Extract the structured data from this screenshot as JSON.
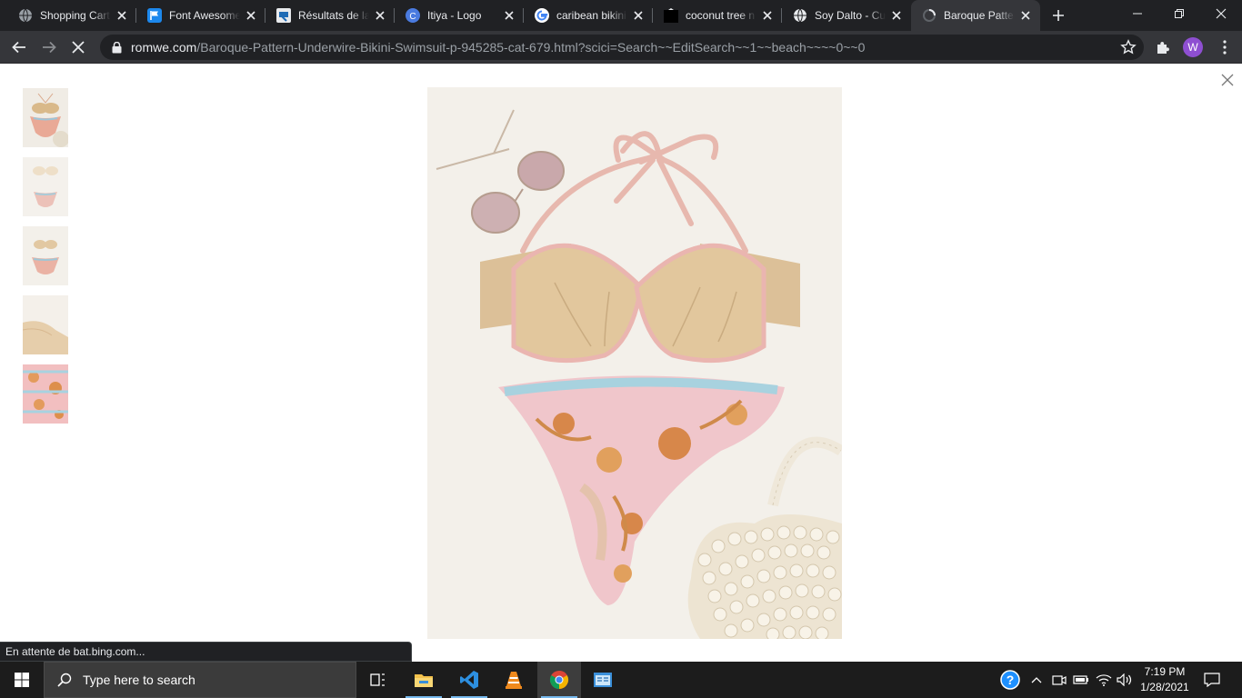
{
  "browser": {
    "tabs": [
      {
        "title": "Shopping Cart",
        "icon": "globe-icon"
      },
      {
        "title": "Font Awesome",
        "icon": "flag-icon"
      },
      {
        "title": "Résultats de la",
        "icon": "image-search-icon"
      },
      {
        "title": "Itiya - Logo",
        "icon": "c-logo-icon"
      },
      {
        "title": "caribean bikini",
        "icon": "google-icon"
      },
      {
        "title": "coconut tree n",
        "icon": "black-square-icon"
      },
      {
        "title": "Soy Dalto - Cu",
        "icon": "globe-icon"
      },
      {
        "title": "Baroque Patter",
        "icon": "loading-icon"
      }
    ],
    "url_host": "romwe.com",
    "url_path": "/Baroque-Pattern-Underwire-Bikini-Swimsuit-p-945285-cat-679.html?scici=Search~~EditSearch~~1~~beach~~~~0~~0",
    "profile_initial": "W",
    "status_text": "En attente de bat.bing.com..."
  },
  "page": {
    "thumbnail_count": 5
  },
  "taskbar": {
    "search_placeholder": "Type here to search",
    "time": "7:19 PM",
    "date": "1/28/2021"
  },
  "colors": {
    "accent": "#8e4fd1",
    "tab_strip": "#202124",
    "toolbar": "#35363a"
  }
}
